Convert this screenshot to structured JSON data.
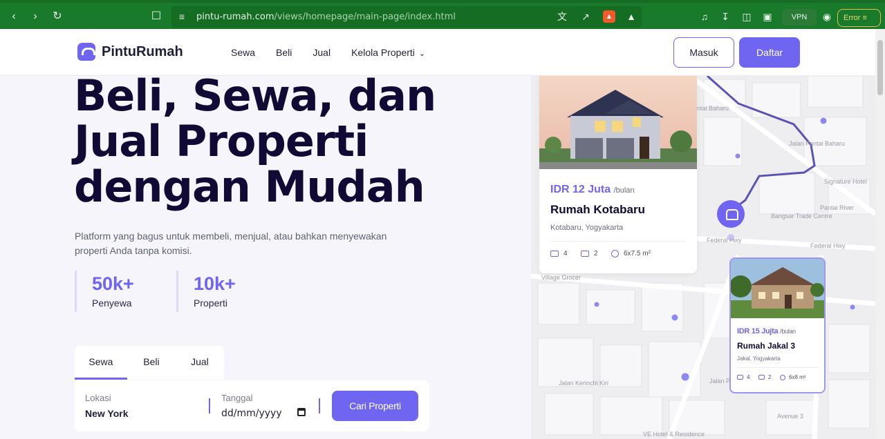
{
  "browser": {
    "url_domain": "pintu-rumah.com",
    "url_path": "/views/homepage/main-page/index.html",
    "vpn_label": "VPN",
    "error_label": "Error"
  },
  "header": {
    "brand": "PintuRumah",
    "nav": [
      {
        "label": "Sewa"
      },
      {
        "label": "Beli"
      },
      {
        "label": "Jual"
      },
      {
        "label": "Kelola Properti"
      }
    ],
    "login_label": "Masuk",
    "signup_label": "Daftar"
  },
  "hero": {
    "title_line1": "Beli, Sewa, dan",
    "title_line2": "Jual Properti",
    "title_line3": "dengan Mudah",
    "description": "Platform yang bagus untuk membeli, menjual, atau bahkan menyewakan properti Anda tanpa komisi.",
    "stats": [
      {
        "value": "50k+",
        "label": "Penyewa"
      },
      {
        "value": "10k+",
        "label": "Properti"
      }
    ]
  },
  "search": {
    "tabs": [
      {
        "label": "Sewa"
      },
      {
        "label": "Beli"
      },
      {
        "label": "Jual"
      }
    ],
    "location_label": "Lokasi",
    "location_value": "New York",
    "date_label": "Tanggal",
    "date_value": "dd/mm/yyyy",
    "submit_label": "Cari Properti"
  },
  "map": {
    "labels": [
      "ntai Baharu",
      "Jalan Pantai Baharu",
      "Signature Hotel",
      "Bangsar Trade Centre",
      "Pantai River",
      "Federal Hwy",
      "Federal Hwy",
      "Jalan Pantai",
      "Jalan Kerinchi Kiri",
      "Avenue 3",
      "VE Hotel & Residence",
      "Village Grocer"
    ]
  },
  "listings": [
    {
      "price": "IDR 12 Juta",
      "period": "/bulan",
      "name": "Rumah Kotabaru",
      "location": "Kotabaru, Yogyakarta",
      "beds": "4",
      "baths": "2",
      "area": "6x7.5 m²"
    },
    {
      "price": "IDR 15 Jujta",
      "period": "/bulan",
      "name": "Rumah Jakal 3",
      "location": "Jakal, Yogyakarta",
      "beds": "4",
      "baths": "2",
      "area": "6x8 m²"
    }
  ],
  "colors": {
    "primary": "#7065f0",
    "heading": "#100a35",
    "browser_green": "#1a7a2b"
  }
}
